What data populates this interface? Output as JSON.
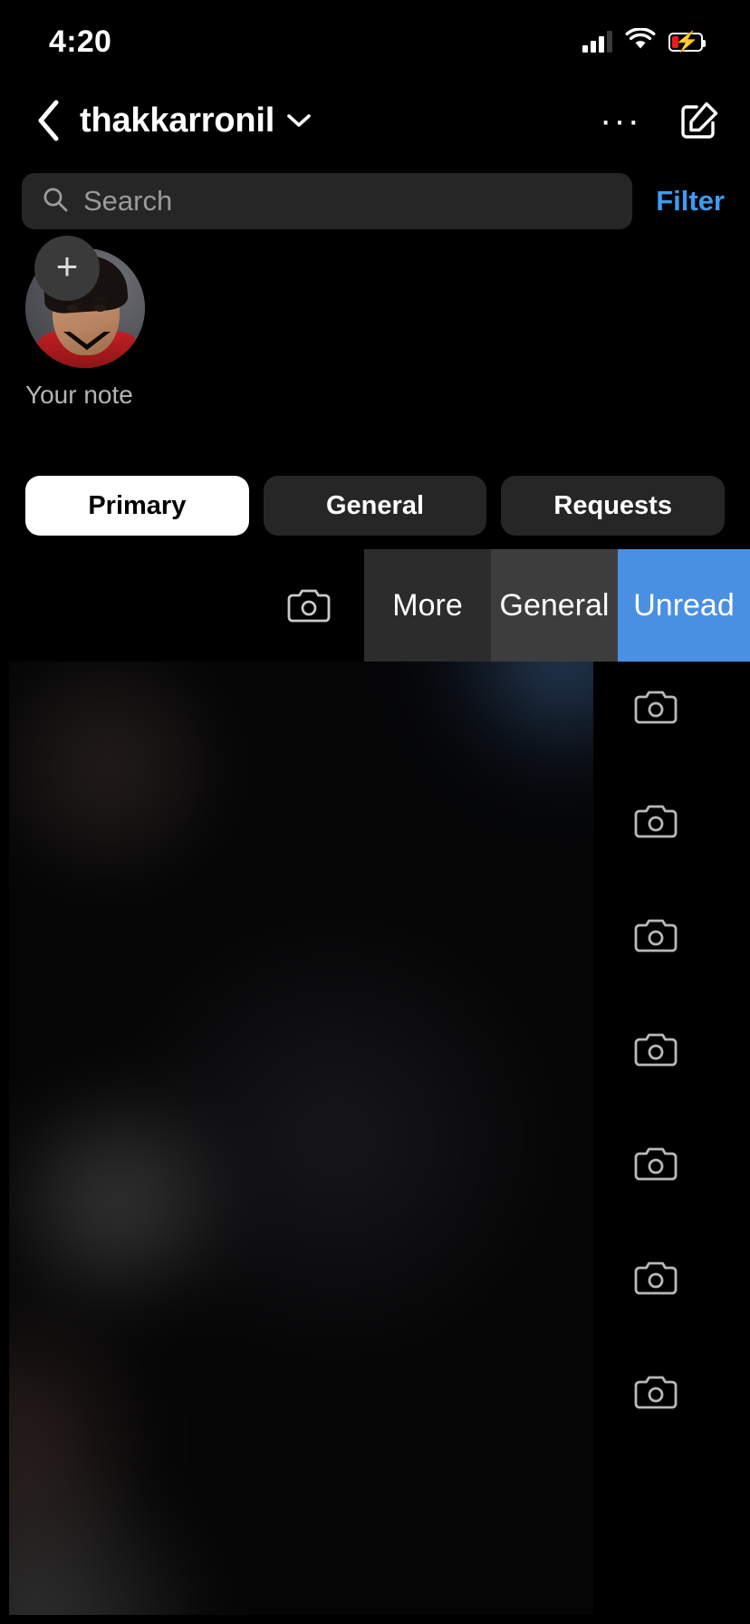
{
  "status_bar": {
    "time": "4:20",
    "signal_icon": "cellular-signal-icon",
    "wifi_icon": "wifi-icon",
    "battery_icon": "battery-charging-icon",
    "battery_level_percent": 12,
    "battery_color": "#f01a1a",
    "charging": true
  },
  "header": {
    "back_icon": "chevron-left-icon",
    "username": "thakkarronil",
    "caret_icon": "chevron-down-icon",
    "more_label": "···",
    "more_icon": "ellipsis-icon",
    "compose_icon": "new-message-compose-icon"
  },
  "search": {
    "icon": "search-icon",
    "placeholder": "Search",
    "value": "",
    "filter_label": "Filter",
    "filter_color": "#3e9bf0"
  },
  "notes": {
    "add_note_icon": "plus-icon",
    "add_note_glyph": "+",
    "avatar_icon": "user-avatar",
    "label": "Your note"
  },
  "inbox_tabs": {
    "items": [
      {
        "label": "Primary",
        "active": true
      },
      {
        "label": "General",
        "active": false
      },
      {
        "label": "Requests",
        "active": false
      }
    ]
  },
  "swipe_actions": {
    "camera_icon": "camera-icon",
    "buttons": [
      {
        "label": "More",
        "color": "#2c2c2c"
      },
      {
        "label": "General",
        "color": "#3d3d3d"
      },
      {
        "label": "Unread",
        "color": "#4a90e2"
      }
    ]
  },
  "thread_list": {
    "blurred": true,
    "camera_icon": "camera-icon",
    "camera_icon_count": 7
  }
}
